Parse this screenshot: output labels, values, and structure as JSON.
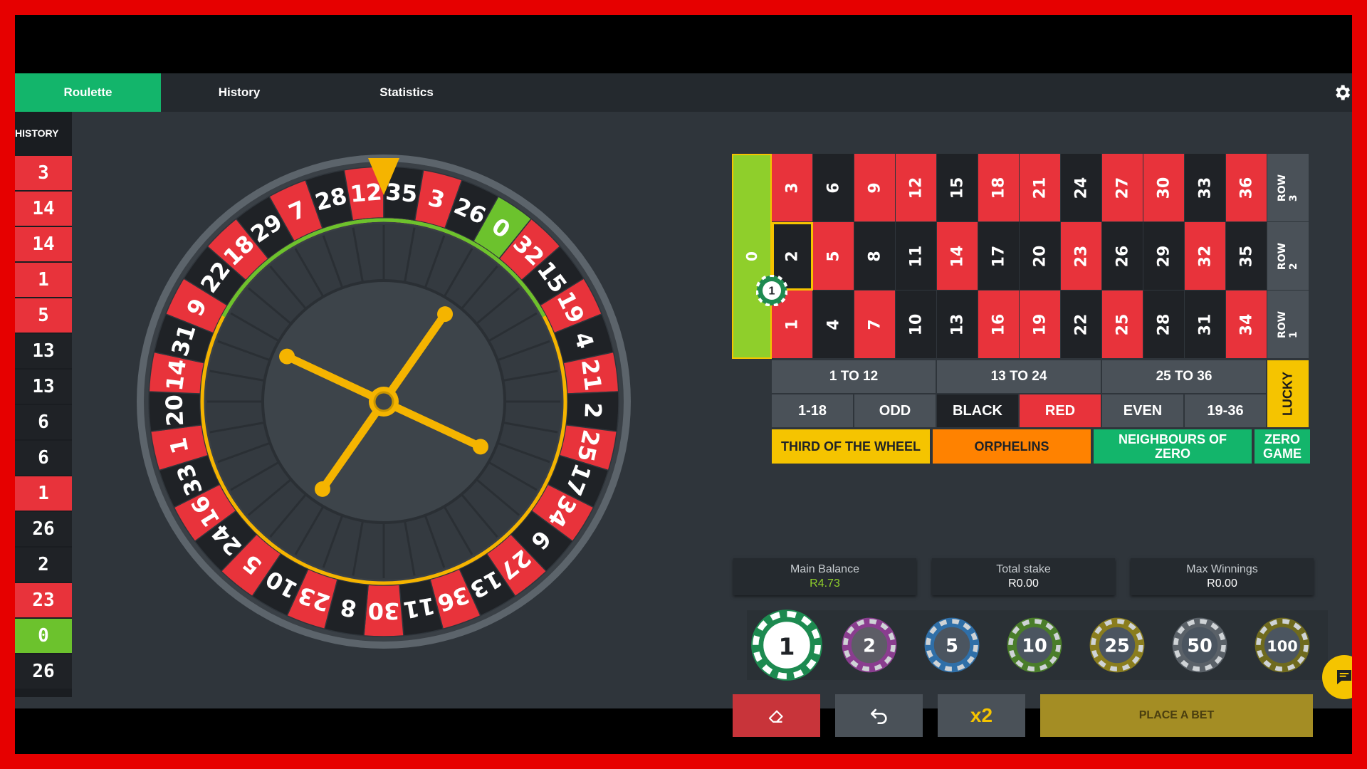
{
  "tabs": [
    "Roulette",
    "History",
    "Statistics"
  ],
  "history": {
    "title": "HISTORY",
    "results": [
      {
        "n": "3",
        "c": "red"
      },
      {
        "n": "14",
        "c": "red"
      },
      {
        "n": "14",
        "c": "red"
      },
      {
        "n": "1",
        "c": "red"
      },
      {
        "n": "5",
        "c": "red"
      },
      {
        "n": "13",
        "c": "black"
      },
      {
        "n": "13",
        "c": "black"
      },
      {
        "n": "6",
        "c": "black"
      },
      {
        "n": "6",
        "c": "black"
      },
      {
        "n": "1",
        "c": "red"
      },
      {
        "n": "26",
        "c": "black"
      },
      {
        "n": "2",
        "c": "black"
      },
      {
        "n": "23",
        "c": "red"
      },
      {
        "n": "0",
        "c": "green"
      },
      {
        "n": "26",
        "c": "black"
      }
    ]
  },
  "wheel_numbers": [
    "0",
    "32",
    "15",
    "19",
    "4",
    "21",
    "2",
    "25",
    "17",
    "34",
    "6",
    "27",
    "13",
    "36",
    "11",
    "30",
    "8",
    "23",
    "10",
    "5",
    "24",
    "16",
    "33",
    "1",
    "20",
    "14",
    "31",
    "9",
    "22",
    "18",
    "29",
    "7",
    "28",
    "12",
    "35",
    "3",
    "26"
  ],
  "red_numbers": [
    1,
    3,
    5,
    7,
    9,
    12,
    14,
    16,
    18,
    19,
    21,
    23,
    25,
    27,
    30,
    32,
    34,
    36
  ],
  "board": {
    "zero": "0",
    "row_labels": [
      "ROW 3",
      "ROW 2",
      "ROW 1"
    ],
    "dozens": [
      "1 TO 12",
      "13 TO 24",
      "25 TO 36"
    ],
    "outside": [
      "1-18",
      "ODD",
      "BLACK",
      "RED",
      "EVEN",
      "19-36"
    ],
    "lucky": "LUCKY",
    "specials": [
      "THIRD OF THE WHEEL",
      "ORPHELINS",
      "NEIGHBOURS OF ZERO",
      "ZERO GAME"
    ],
    "placed_bet": {
      "number": "2",
      "chip": "1"
    }
  },
  "balances": {
    "main_label": "Main Balance",
    "main_value": "R4.73",
    "stake_label": "Total stake",
    "stake_value": "R0.00",
    "win_label": "Max Winnings",
    "win_value": "R0.00"
  },
  "chips": [
    "1",
    "2",
    "5",
    "10",
    "25",
    "50",
    "100"
  ],
  "selected_chip": "1",
  "actions": {
    "double": "x2",
    "place_bet": "PLACE A BET"
  },
  "colors": {
    "red": "#e8333b",
    "black": "#1f2226",
    "green": "#6cc22d",
    "accent": "#13b56b",
    "gold": "#f5c400"
  }
}
